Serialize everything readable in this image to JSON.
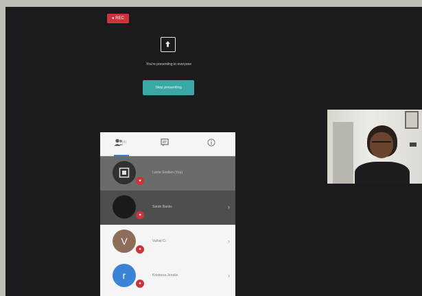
{
  "recording": {
    "label": "● REC"
  },
  "presenting": {
    "message": "You're presenting to everyone",
    "stop_button": "Stop presenting"
  },
  "panel": {
    "tabs": [
      {
        "icon": "people-icon",
        "count": "(4)"
      },
      {
        "icon": "chat-icon"
      },
      {
        "icon": "info-icon"
      }
    ],
    "participants": [
      {
        "name": "Lorrie Snellen (You)",
        "initial": "",
        "avatar_color": "#2f3030",
        "badge": "●"
      },
      {
        "name": "Sarah Banks",
        "initial": "",
        "avatar_color": "#1a1a1a",
        "badge": "●"
      },
      {
        "name": "Valhal Ci",
        "initial": "V",
        "avatar_color": "#8e6d5a",
        "badge": "●"
      },
      {
        "name": "Kristrena Jenelle",
        "initial": "r",
        "avatar_color": "#3b83d6",
        "badge": "●"
      }
    ]
  },
  "colors": {
    "screen_bg": "#1b1b1d",
    "accent_teal": "#3aa8a4",
    "rec_red": "#c9353a",
    "tab_active": "#2a7ee0"
  }
}
